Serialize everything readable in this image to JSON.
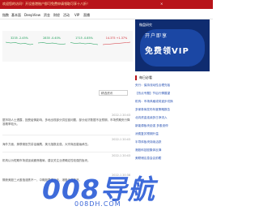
{
  "topbar": {
    "notice": "欢迎您的访问！开设香港账户即可免费申请领取可享十八折！",
    "close": "×"
  },
  "nav": {
    "items": [
      "指数",
      "基本面",
      "DeepView",
      "资金",
      "财经",
      "活动",
      "VIP",
      "直播"
    ]
  },
  "quotes": [
    {
      "name": "",
      "price": "",
      "change": "3235 -2.45%",
      "trend": "fall"
    },
    {
      "name": "",
      "price": "",
      "change": "2835 -0.40%",
      "trend": "fall"
    },
    {
      "name": "",
      "price": "",
      "change": "1715 -0.85%",
      "trend": "fall"
    },
    {
      "name": "",
      "price": "",
      "change": "14.375 +1.37%",
      "trend": "rise"
    }
  ],
  "ad": {
    "brand": "微盘研究",
    "line1": "开户即享",
    "line2": "免费领VIP",
    "sub": ""
  },
  "filter": {
    "label": "精选资讯"
  },
  "articles": [
    {
      "time": "2022-1 20:43",
      "text": "据市场人士透露，因受疫情影响，多地出现部分供应链问题，部分经济数据不及预期，市场预期央行降准概率较大。"
    },
    {
      "time": "2022-1 20:43",
      "text": "海外方面，美联储官员讲话偏鹰，美元指数走强，大宗商品普遍承压。"
    },
    {
      "time": "2022-1 20:43",
      "text": "机构认为短期市场或延续震荡格局，建议关注业绩确定性较强的板块。"
    },
    {
      "time": "2022-1 20:38",
      "text": "隔夜美股三大股指涨跌不一，中概股表现分化，港股今日高开。"
    }
  ],
  "sidebar": {
    "heading": "每日必看",
    "items": [
      "央行：保持流动性合理充裕",
      "【热点专题】节后行情展望",
      "机构：市场风格或将逐步切换",
      "多家券商发布年度策略报告",
      "北向资金连续多日净流入",
      "新能源板块走强 多股涨停",
      "消费复苏预期升温",
      "半导体板块持续活跃",
      "港股科技股集体反弹",
      "美联储议息会议前瞻"
    ]
  },
  "watermark": {
    "big": "008导航",
    "small": "008DH.COM"
  }
}
